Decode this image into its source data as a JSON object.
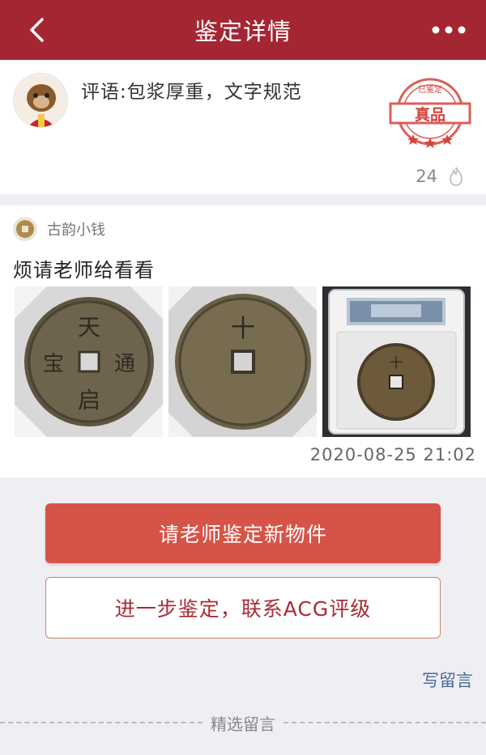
{
  "header": {
    "title": "鉴定详情",
    "back_icon": "chevron-left-icon",
    "more_icon": "more-dots-icon",
    "bg_color": "#a42632"
  },
  "review": {
    "comment": "评语:包浆厚重，文字规范",
    "seal_line1": "已鉴定",
    "seal_line2": "真品",
    "fire_count": "24",
    "fire_icon": "flame-icon"
  },
  "post": {
    "author": "古韵小钱",
    "text": "烦请老师给看看",
    "timestamp": "2020-08-25  21:02",
    "photos": [
      {
        "name": "coin-obverse-photo",
        "inscription": "天启通宝"
      },
      {
        "name": "coin-reverse-photo",
        "inscription": "十"
      },
      {
        "name": "coin-slab-photo"
      }
    ]
  },
  "actions": {
    "primary_label": "请老师鉴定新物件",
    "secondary_label": "进一步鉴定，联系ACG评级",
    "write_comment": "写留言"
  },
  "comments_section": {
    "label": "精选留言"
  },
  "colors": {
    "accent": "#a42632",
    "primary_button": "#d65447",
    "secondary_text": "#a82c34",
    "link": "#4d6a9a"
  }
}
